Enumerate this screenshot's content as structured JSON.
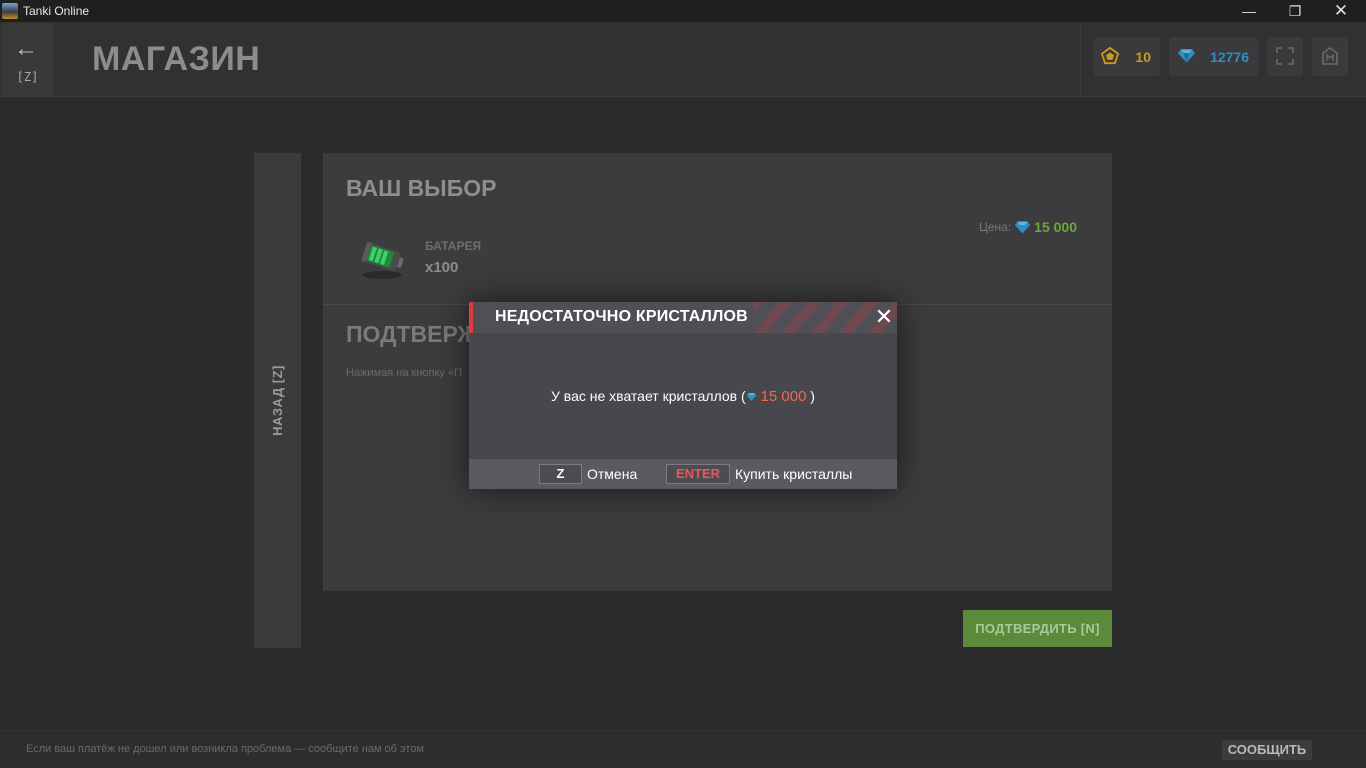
{
  "window": {
    "title": "Tanki Online",
    "minimize": "—",
    "maximize": "❐",
    "close": "✕"
  },
  "header": {
    "back_arrow": "←",
    "back_key": "[Z]",
    "title": "МАГАЗИН",
    "stars_value": "10",
    "crystals_value": "12776",
    "colors": {
      "stars": "#c99a1b",
      "crystals": "#2e8fc0"
    }
  },
  "back_panel": {
    "label": "НАЗАД [Z]"
  },
  "selection": {
    "title": "ВАШ ВЫБОР",
    "price_label": "Цена:",
    "price_value": "15 000",
    "item_name": "БАТАРЕЯ",
    "item_qty": "x100"
  },
  "confirm_section": {
    "title": "ПОДТВЕРЖД",
    "note": "Нажимая на кнопку «П"
  },
  "confirm_button": {
    "label": "ПОДТВЕРДИТЬ [N]"
  },
  "footer": {
    "text": "Если ваш платёж не дошел или возникла проблема — сообщите нам об этом",
    "report_label": "СООБЩИТЬ"
  },
  "dialog": {
    "title": "НЕДОСТАТОЧНО КРИСТАЛЛОВ",
    "close_glyph": "✕",
    "message_prefix": "У вас не хватает кристаллов (",
    "amount": "15 000",
    "message_suffix": " )",
    "cancel_key": "Z",
    "cancel_label": "Отмена",
    "buy_key": "ENTER",
    "buy_label": "Купить кристаллы",
    "accent": "#e0393e"
  }
}
